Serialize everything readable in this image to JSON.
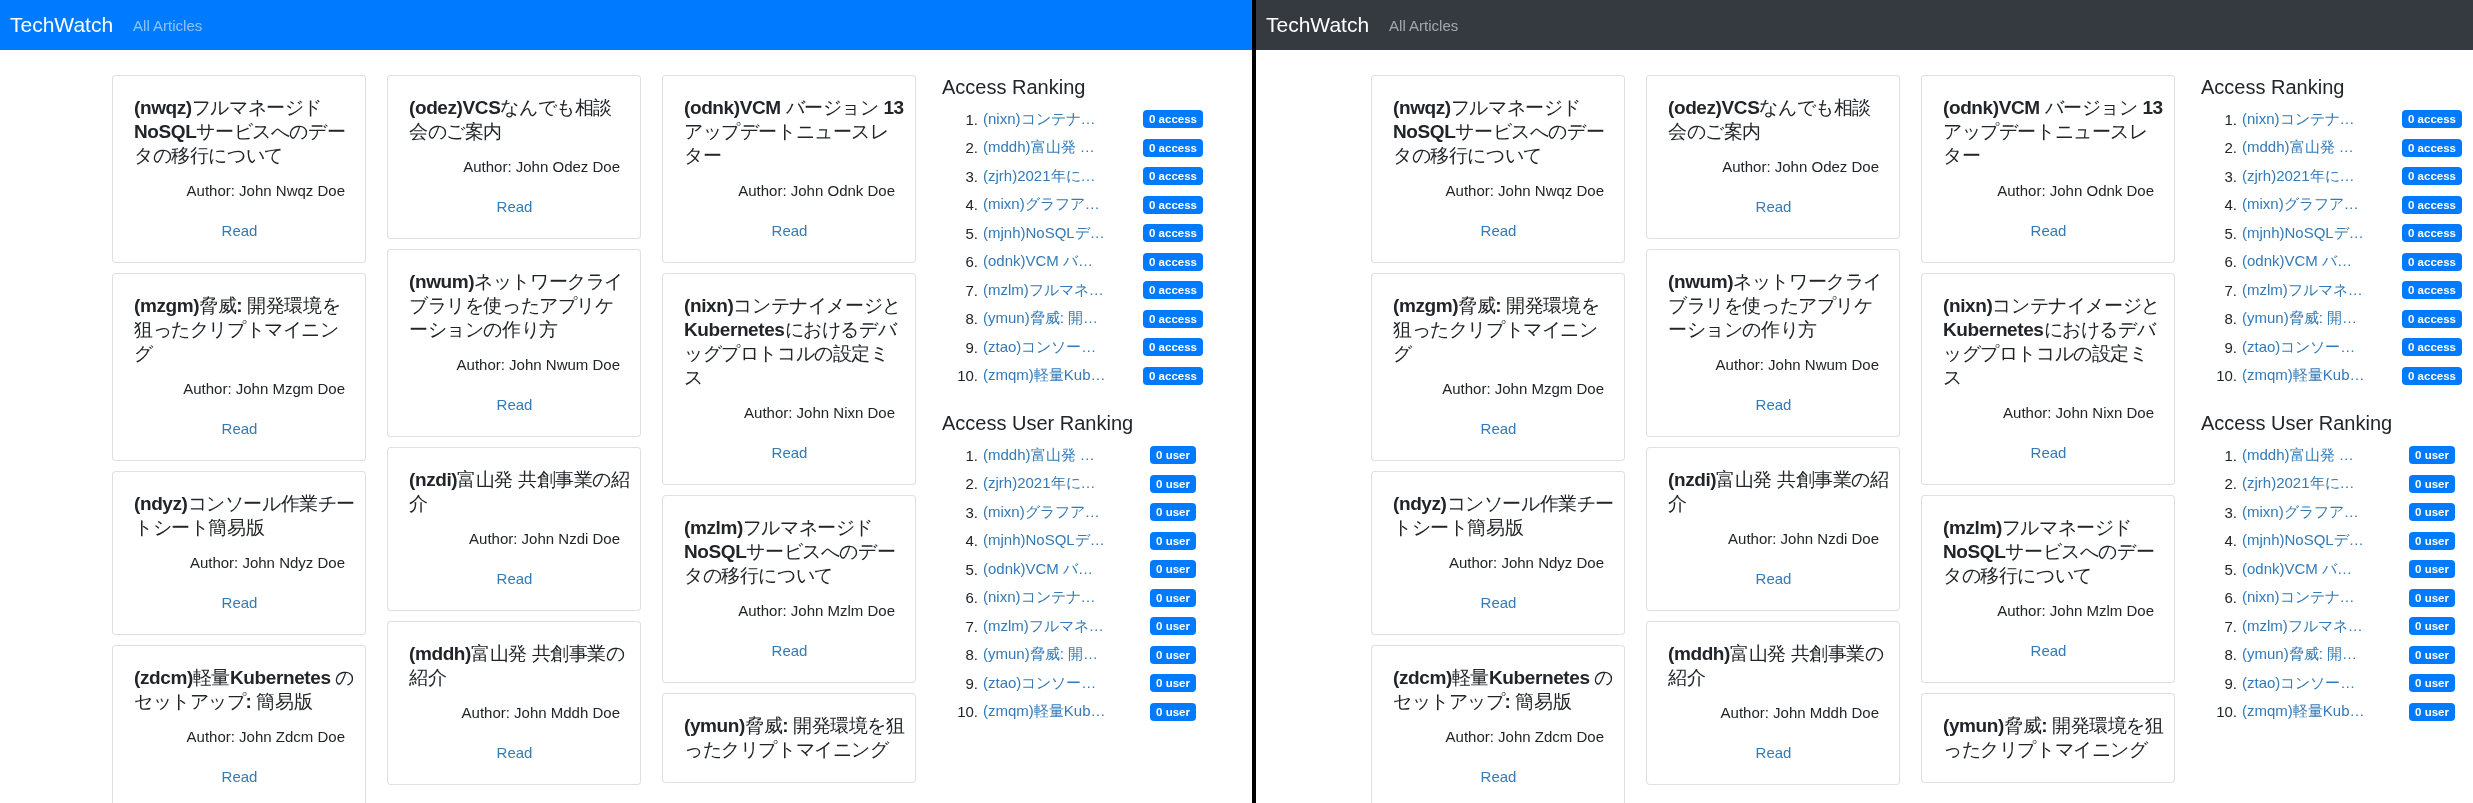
{
  "panes": [
    {
      "navbar": {
        "color": "#007bff",
        "brand": "TechWatch",
        "links": [
          {
            "label": "All Articles",
            "selected": false
          }
        ]
      },
      "columns": [
        [
          {
            "title": "**(nwqz)**フルマネージド**NoSQL**サービスへのデータの移行について",
            "author": "Author: John Nwqz Doe",
            "action": "Read"
          },
          {
            "title": "**(mzgm)**脅威**:** 開発環境を狙ったクリプトマイニング",
            "author": "Author: John Mzgm Doe",
            "action": "Read"
          },
          {
            "title": "**(ndyz)**コンソール作業チートシート簡易版",
            "author": "Author: John Ndyz Doe",
            "action": "Read"
          },
          {
            "title": "**(zdcm)**軽量**Kubernetes** のセットアップ**:** 簡易版",
            "author": "Author: John Zdcm Doe",
            "action": "Read"
          }
        ],
        [
          {
            "title": "**(odez)VCS**なんでも相談会のご案内",
            "author": "Author: John Odez Doe",
            "action": "Read"
          },
          {
            "title": "**(nwum)**ネットワークライブラリを使ったアプリケーションの作り方",
            "author": "Author: John Nwum Doe",
            "action": "Read"
          },
          {
            "title": "**(nzdi)**富山発 共創事業の紹介",
            "author": "Author: John Nzdi Doe",
            "action": "Read"
          },
          {
            "title": "**(mddh)**富山発 共創事業の紹介",
            "author": "Author: John Mddh Doe",
            "action": "Read"
          }
        ],
        [
          {
            "title": "**(odnk)VCM** バージョン **13** アップデートニュースレター",
            "author": "Author: John Odnk Doe",
            "action": "Read"
          },
          {
            "title": "**(nixn)**コンテナイメージと**Kubernetes**におけるデバッグプロトコルの設定ミス",
            "author": "Author: John Nixn Doe",
            "action": "Read"
          },
          {
            "title": "**(mzlm)**フルマネージド**NoSQL**サービスへのデータの移行について",
            "author": "Author: John Mzlm Doe",
            "action": "Read"
          },
          {
            "title": "**(ymun)**脅威**:** 開発環境を狙ったクリプトマイニング"
          }
        ]
      ],
      "rankings": [
        {
          "title": "Access Ranking",
          "items": [
            {
              "rank": "1.",
              "title": "(nixn)コンテナ…",
              "badge": "0 access"
            },
            {
              "rank": "2.",
              "title": "(mddh)富山発 …",
              "badge": "0 access"
            },
            {
              "rank": "3.",
              "title": "(zjrh)2021年に…",
              "badge": "0 access"
            },
            {
              "rank": "4.",
              "title": "(mixn)グラフア…",
              "badge": "0 access"
            },
            {
              "rank": "5.",
              "title": "(mjnh)NoSQLデ…",
              "badge": "0 access"
            },
            {
              "rank": "6.",
              "title": "(odnk)VCM バ…",
              "badge": "0 access"
            },
            {
              "rank": "7.",
              "title": "(mzlm)フルマネ…",
              "badge": "0 access"
            },
            {
              "rank": "8.",
              "title": "(ymun)脅威: 開…",
              "badge": "0 access"
            },
            {
              "rank": "9.",
              "title": "(ztao)コンソー…",
              "badge": "0 access"
            },
            {
              "rank": "10.",
              "title": "(zmqm)軽量Kub…",
              "badge": "0 access"
            }
          ]
        },
        {
          "title": "Access User Ranking",
          "items": [
            {
              "rank": "1.",
              "title": "(mddh)富山発 …",
              "badge": "0 user"
            },
            {
              "rank": "2.",
              "title": "(zjrh)2021年に…",
              "badge": "0 user"
            },
            {
              "rank": "3.",
              "title": "(mixn)グラフア…",
              "badge": "0 user"
            },
            {
              "rank": "4.",
              "title": "(mjnh)NoSQLデ…",
              "badge": "0 user"
            },
            {
              "rank": "5.",
              "title": "(odnk)VCM バ…",
              "badge": "0 user"
            },
            {
              "rank": "6.",
              "title": "(nixn)コンテナ…",
              "badge": "0 user"
            },
            {
              "rank": "7.",
              "title": "(mzlm)フルマネ…",
              "badge": "0 user"
            },
            {
              "rank": "8.",
              "title": "(ymun)脅威: 開…",
              "badge": "0 user"
            },
            {
              "rank": "9.",
              "title": "(ztao)コンソー…",
              "badge": "0 user"
            },
            {
              "rank": "10.",
              "title": "(zmqm)軽量Kub…",
              "badge": "0 user"
            }
          ]
        }
      ]
    },
    {
      "navbar": {
        "color": "#343a40",
        "brand": "TechWatch",
        "links": [
          {
            "label": "All Articles",
            "selected": false
          }
        ]
      },
      "columns": [
        [
          {
            "title": "**(nwqz)**フルマネージド**NoSQL**サービスへのデータの移行について",
            "author": "Author: John Nwqz Doe",
            "action": "Read"
          },
          {
            "title": "**(mzgm)**脅威**:** 開発環境を狙ったクリプトマイニング",
            "author": "Author: John Mzgm Doe",
            "action": "Read"
          },
          {
            "title": "**(ndyz)**コンソール作業チートシート簡易版",
            "author": "Author: John Ndyz Doe",
            "action": "Read"
          },
          {
            "title": "**(zdcm)**軽量**Kubernetes** のセットアップ**:** 簡易版",
            "author": "Author: John Zdcm Doe",
            "action": "Read"
          }
        ],
        [
          {
            "title": "**(odez)VCS**なんでも相談会のご案内",
            "author": "Author: John Odez Doe",
            "action": "Read"
          },
          {
            "title": "**(nwum)**ネットワークライブラリを使ったアプリケーションの作り方",
            "author": "Author: John Nwum Doe",
            "action": "Read"
          },
          {
            "title": "**(nzdi)**富山発 共創事業の紹介",
            "author": "Author: John Nzdi Doe",
            "action": "Read"
          },
          {
            "title": "**(mddh)**富山発 共創事業の紹介",
            "author": "Author: John Mddh Doe",
            "action": "Read"
          }
        ],
        [
          {
            "title": "**(odnk)VCM** バージョン **13** アップデートニュースレター",
            "author": "Author: John Odnk Doe",
            "action": "Read"
          },
          {
            "title": "**(nixn)**コンテナイメージと**Kubernetes**におけるデバッグプロトコルの設定ミス",
            "author": "Author: John Nixn Doe",
            "action": "Read"
          },
          {
            "title": "**(mzlm)**フルマネージド**NoSQL**サービスへのデータの移行について",
            "author": "Author: John Mzlm Doe",
            "action": "Read"
          },
          {
            "title": "**(ymun)**脅威**:** 開発環境を狙ったクリプトマイニング"
          }
        ]
      ],
      "rankings": [
        {
          "title": "Access Ranking",
          "items": [
            {
              "rank": "1.",
              "title": "(nixn)コンテナ…",
              "badge": "0 access"
            },
            {
              "rank": "2.",
              "title": "(mddh)富山発 …",
              "badge": "0 access"
            },
            {
              "rank": "3.",
              "title": "(zjrh)2021年に…",
              "badge": "0 access"
            },
            {
              "rank": "4.",
              "title": "(mixn)グラフア…",
              "badge": "0 access"
            },
            {
              "rank": "5.",
              "title": "(mjnh)NoSQLデ…",
              "badge": "0 access"
            },
            {
              "rank": "6.",
              "title": "(odnk)VCM バ…",
              "badge": "0 access"
            },
            {
              "rank": "7.",
              "title": "(mzlm)フルマネ…",
              "badge": "0 access"
            },
            {
              "rank": "8.",
              "title": "(ymun)脅威: 開…",
              "badge": "0 access"
            },
            {
              "rank": "9.",
              "title": "(ztao)コンソー…",
              "badge": "0 access"
            },
            {
              "rank": "10.",
              "title": "(zmqm)軽量Kub…",
              "badge": "0 access"
            }
          ]
        },
        {
          "title": "Access User Ranking",
          "items": [
            {
              "rank": "1.",
              "title": "(mddh)富山発 …",
              "badge": "0 user"
            },
            {
              "rank": "2.",
              "title": "(zjrh)2021年に…",
              "badge": "0 user"
            },
            {
              "rank": "3.",
              "title": "(mixn)グラフア…",
              "badge": "0 user"
            },
            {
              "rank": "4.",
              "title": "(mjnh)NoSQLデ…",
              "badge": "0 user"
            },
            {
              "rank": "5.",
              "title": "(odnk)VCM バ…",
              "badge": "0 user"
            },
            {
              "rank": "6.",
              "title": "(nixn)コンテナ…",
              "badge": "0 user"
            },
            {
              "rank": "7.",
              "title": "(mzlm)フルマネ…",
              "badge": "0 user"
            },
            {
              "rank": "8.",
              "title": "(ymun)脅威: 開…",
              "badge": "0 user"
            },
            {
              "rank": "9.",
              "title": "(ztao)コンソー…",
              "badge": "0 user"
            },
            {
              "rank": "10.",
              "title": "(zmqm)軽量Kub…",
              "badge": "0 user"
            }
          ]
        }
      ]
    }
  ]
}
